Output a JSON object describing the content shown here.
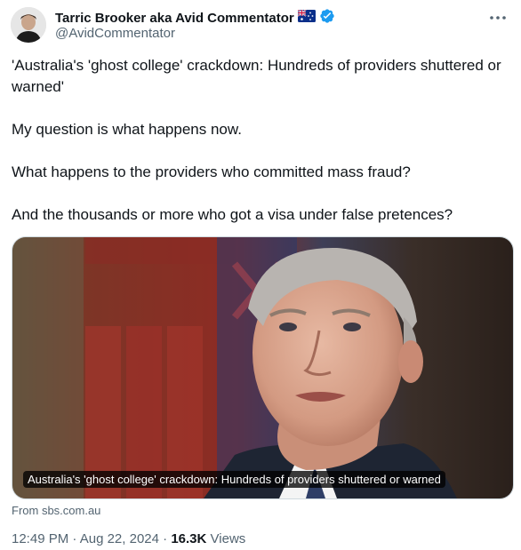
{
  "author": {
    "display_name": "Tarric Brooker aka Avid Commentator",
    "handle": "@AvidCommentator"
  },
  "tweet": {
    "headline": "'Australia's 'ghost college' crackdown: Hundreds of providers shuttered or warned'",
    "line1": "My question is what happens now.",
    "line2": "What happens to the providers who committed mass fraud?",
    "line3": "And the thousands or more who got a visa under false pretences?"
  },
  "card": {
    "caption": "Australia's 'ghost college' crackdown: Hundreds of providers shuttered or warned",
    "source": "From sbs.com.au"
  },
  "meta": {
    "time": "12:49 PM",
    "separator": " · ",
    "date": "Aug 22, 2024",
    "views_count": "16.3K",
    "views_label": "Views"
  },
  "icons": {
    "flag": "australia-flag-icon",
    "verified": "verified-badge-icon",
    "more": "more-options-icon"
  },
  "colors": {
    "verified_blue": "#1d9bf0",
    "secondary_text": "#536471"
  }
}
